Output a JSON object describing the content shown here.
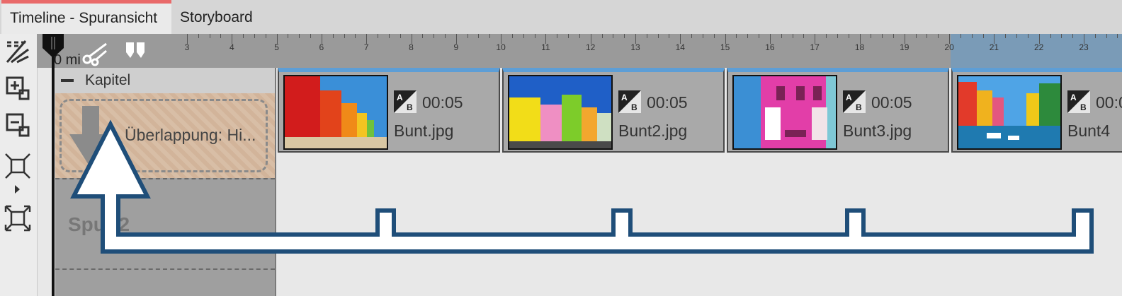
{
  "tabs": [
    {
      "label": "Timeline - Spuransicht",
      "active": true
    },
    {
      "label": "Storyboard",
      "active": false
    }
  ],
  "ruler": {
    "zero_label": "0 mi",
    "ticks": [
      "3",
      "4",
      "5",
      "6",
      "7",
      "8",
      "9",
      "10",
      "11",
      "12",
      "13",
      "14",
      "15",
      "16",
      "17",
      "18",
      "19",
      "20",
      "21",
      "22",
      "23"
    ]
  },
  "track_header": {
    "chapter_label": "Kapitel",
    "overlap_label": "Überlappung: Hi...",
    "track2_label": "Spur 2"
  },
  "clips": [
    {
      "duration": "00:05",
      "filename": "Bunt.jpg"
    },
    {
      "duration": "00:05",
      "filename": "Bunt2.jpg"
    },
    {
      "duration": "00:05",
      "filename": "Bunt3.jpg"
    },
    {
      "duration": "00:05",
      "filename": "Bunt4"
    }
  ],
  "toolbar": {
    "icons": [
      "curve-tool-icon",
      "add-object-icon",
      "remove-object-icon",
      "shrink-icon",
      "expand-icon"
    ]
  },
  "ruler_tools": [
    "cut-icon",
    "marker-icon"
  ],
  "colors": {
    "tab_accent": "#e96a6a",
    "clip_selected": "#5d9ed6",
    "overlap_bg": "#d2b49a",
    "annotation_arrow": "#1f4e79"
  }
}
